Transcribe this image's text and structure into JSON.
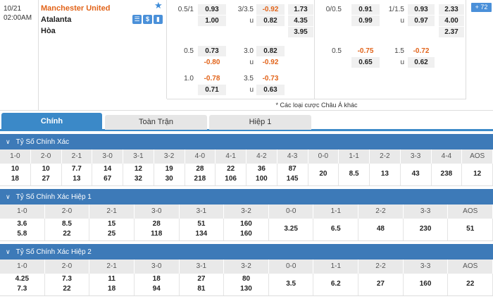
{
  "match": {
    "date": "10/21",
    "time": "02:00AM",
    "home": "Manchester United",
    "away": "Atalanta",
    "draw": "Hòa",
    "more_count": "72",
    "icons": [
      "list-icon",
      "dollar-icon",
      "stats-icon"
    ]
  },
  "odds_ft": {
    "r1": {
      "l1": "0.5/1",
      "v1": "0.93",
      "l2": "3/3.5",
      "v2": "-0.92",
      "x": "1.73"
    },
    "r2": {
      "v1": "1.00",
      "u": "u",
      "v2": "0.82",
      "x": "4.35"
    },
    "r3": {
      "x": "3.95"
    },
    "r4": {
      "l1": "0.5",
      "v1": "0.73",
      "l2": "3.0",
      "v2": "0.82"
    },
    "r5": {
      "v1": "-0.80",
      "u": "u",
      "v2": "-0.92"
    },
    "r6": {
      "l1": "1.0",
      "v1": "-0.78",
      "l2": "3.5",
      "v2": "-0.73"
    },
    "r7": {
      "v1": "0.71",
      "u": "u",
      "v2": "0.63"
    }
  },
  "odds_ht": {
    "r1": {
      "l1": "0/0.5",
      "v1": "0.91",
      "l2": "1/1.5",
      "v2": "0.93",
      "x": "2.33"
    },
    "r2": {
      "v1": "0.99",
      "u": "u",
      "v2": "0.97",
      "x": "4.00"
    },
    "r3": {
      "x": "2.37"
    },
    "r4": {
      "l1": "0.5",
      "v1": "-0.75",
      "l2": "1.5",
      "v2": "-0.72"
    },
    "r5": {
      "v1": "0.65",
      "u": "u",
      "v2": "0.62"
    }
  },
  "other_odds": "* Các loại cược Châu Á khác",
  "tabs": [
    "Chính",
    "Toàn Trận",
    "Hiệp 1"
  ],
  "sections": [
    {
      "title": "Tỷ Số Chính Xác",
      "headers": [
        "1-0",
        "2-0",
        "2-1",
        "3-0",
        "3-1",
        "3-2",
        "4-0",
        "4-1",
        "4-2",
        "4-3",
        "0-0",
        "1-1",
        "2-2",
        "3-3",
        "4-4",
        "AOS"
      ],
      "cells": [
        [
          "10",
          "18"
        ],
        [
          "10",
          "27"
        ],
        [
          "7.7",
          "13"
        ],
        [
          "14",
          "67"
        ],
        [
          "12",
          "32"
        ],
        [
          "19",
          "30"
        ],
        [
          "28",
          "218"
        ],
        [
          "22",
          "106"
        ],
        [
          "36",
          "100"
        ],
        [
          "87",
          "145"
        ],
        [
          "20"
        ],
        [
          "8.5"
        ],
        [
          "13"
        ],
        [
          "43"
        ],
        [
          "238"
        ],
        [
          "12"
        ]
      ]
    },
    {
      "title": "Tỷ Số Chính Xác Hiệp 1",
      "headers": [
        "1-0",
        "2-0",
        "2-1",
        "3-0",
        "3-1",
        "3-2",
        "0-0",
        "1-1",
        "2-2",
        "3-3",
        "AOS"
      ],
      "cells": [
        [
          "3.6",
          "5.8"
        ],
        [
          "8.5",
          "22"
        ],
        [
          "15",
          "25"
        ],
        [
          "28",
          "118"
        ],
        [
          "51",
          "134"
        ],
        [
          "160",
          "160"
        ],
        [
          "3.25"
        ],
        [
          "6.5"
        ],
        [
          "48"
        ],
        [
          "230"
        ],
        [
          "51"
        ]
      ]
    },
    {
      "title": "Tỷ Số Chính Xác Hiệp 2",
      "headers": [
        "1-0",
        "2-0",
        "2-1",
        "3-0",
        "3-1",
        "3-2",
        "0-0",
        "1-1",
        "2-2",
        "3-3",
        "AOS"
      ],
      "cells": [
        [
          "4.25",
          "7.3"
        ],
        [
          "7.3",
          "22"
        ],
        [
          "11",
          "18"
        ],
        [
          "18",
          "94"
        ],
        [
          "27",
          "81"
        ],
        [
          "80",
          "130"
        ],
        [
          "3.5"
        ],
        [
          "6.2"
        ],
        [
          "27"
        ],
        [
          "160"
        ],
        [
          "22"
        ]
      ]
    }
  ]
}
